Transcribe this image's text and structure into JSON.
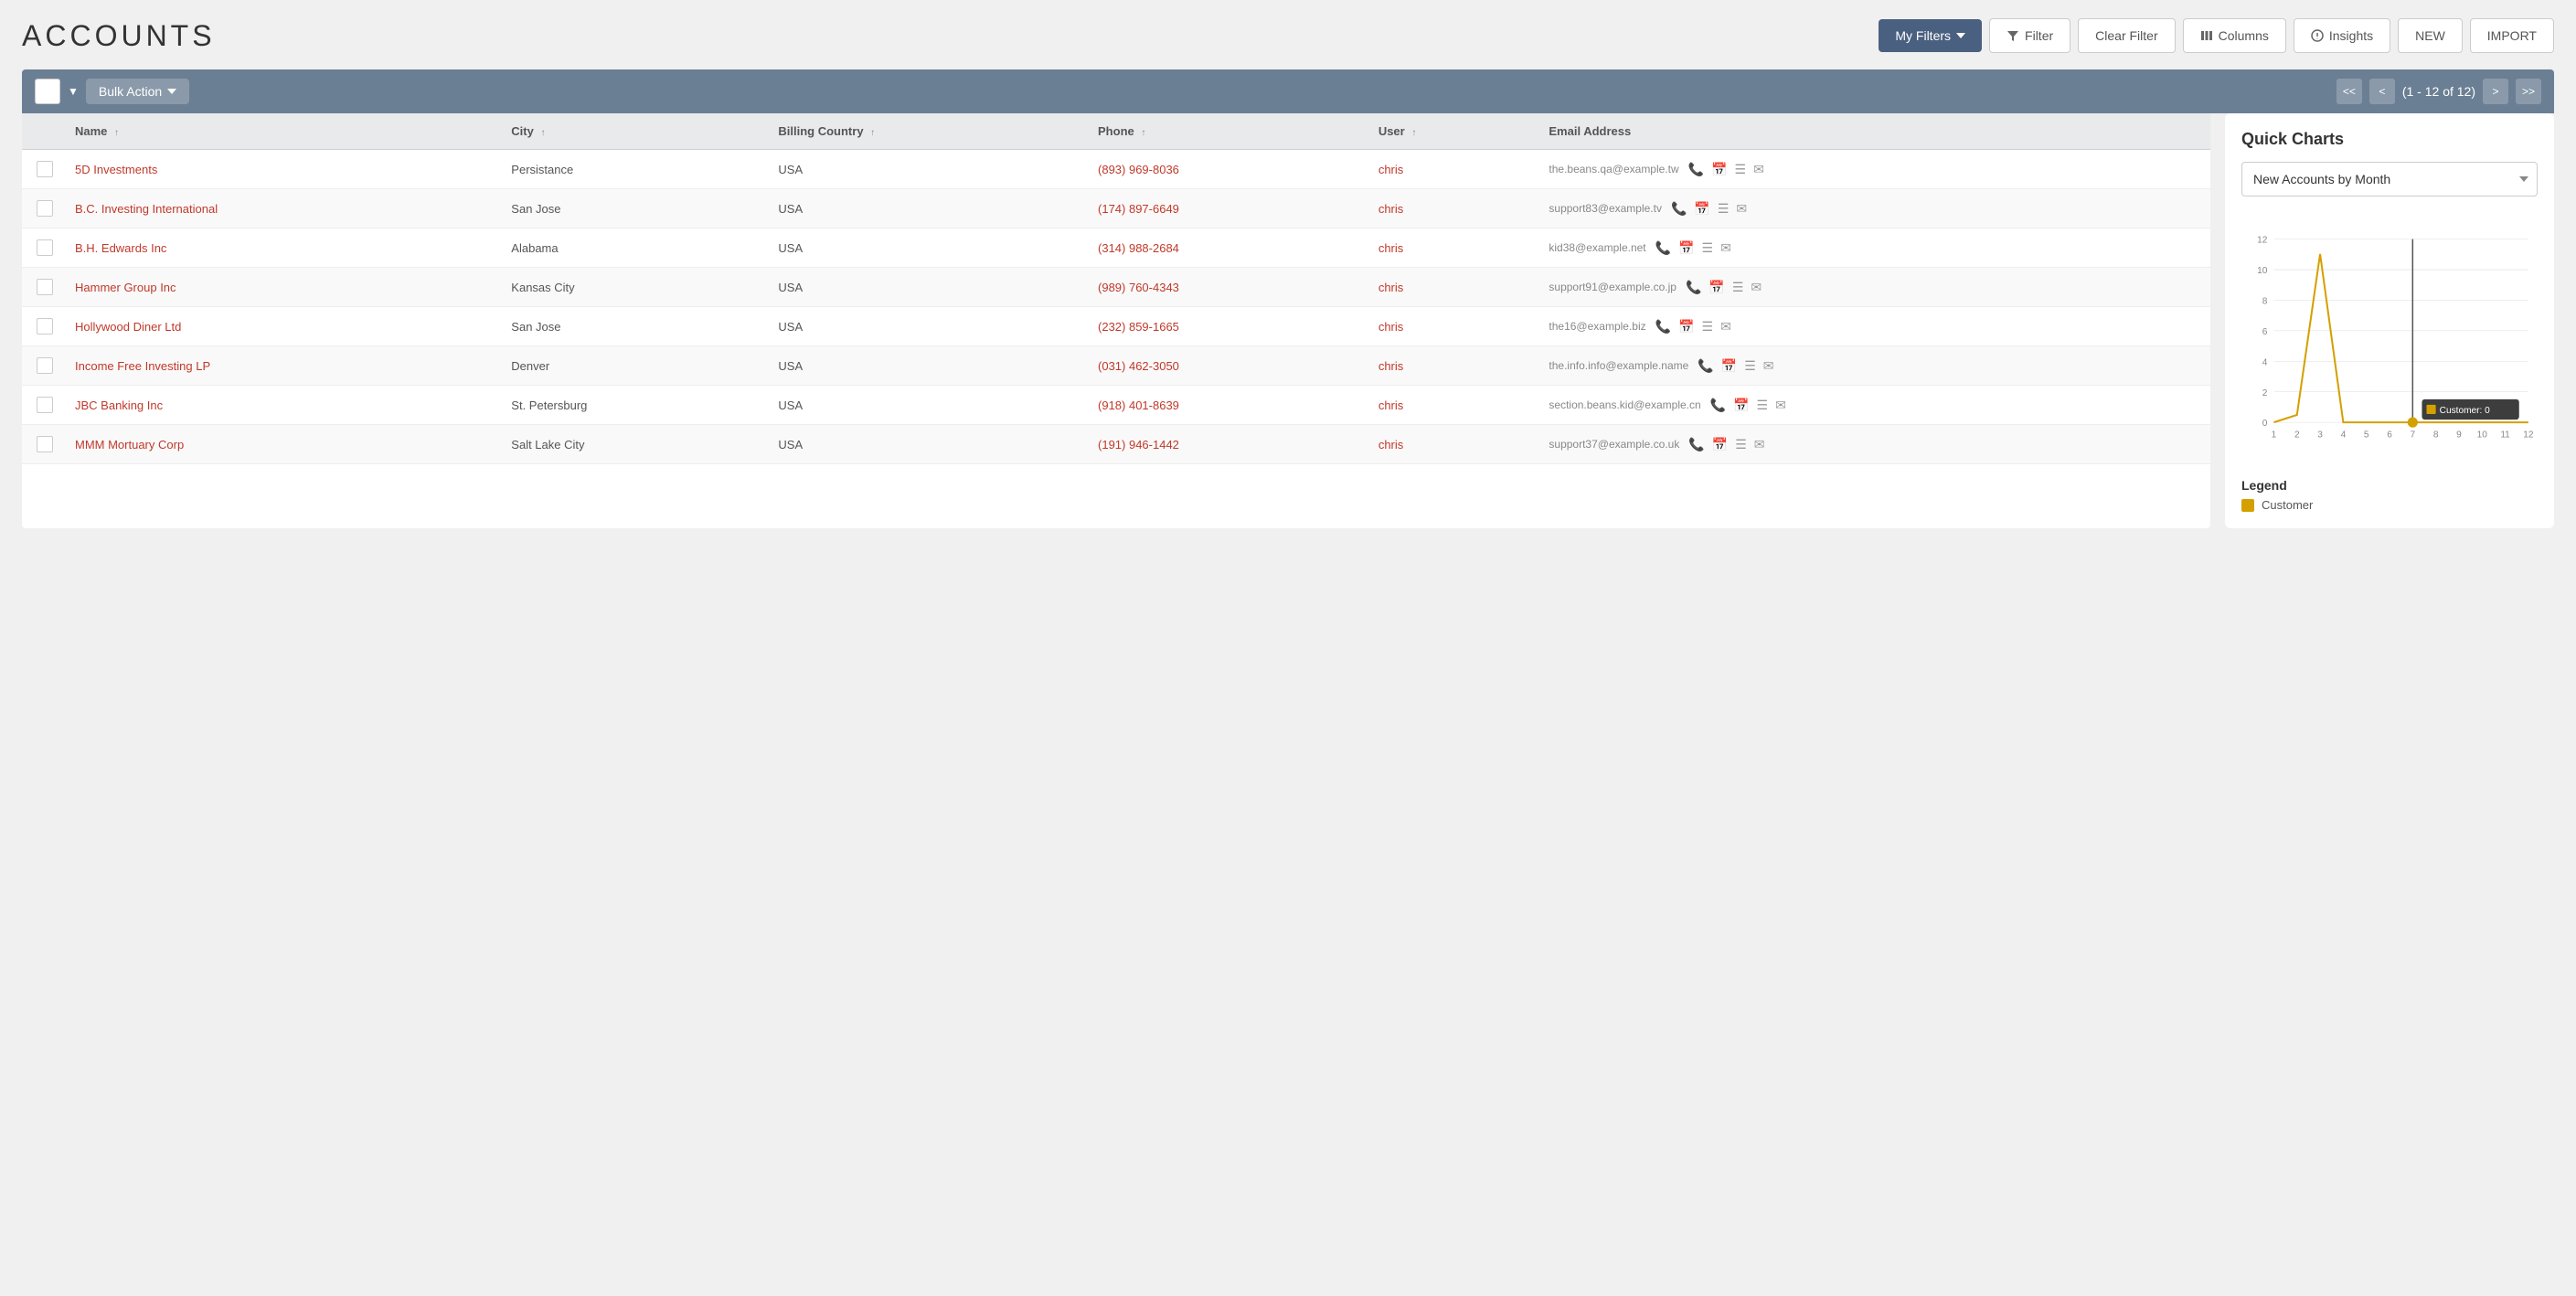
{
  "page": {
    "title": "ACCOUNTS"
  },
  "header": {
    "new_label": "NEW",
    "import_label": "IMPORT",
    "my_filters_label": "My Filters",
    "filter_label": "Filter",
    "clear_filter_label": "Clear Filter",
    "columns_label": "Columns",
    "insights_label": "Insights"
  },
  "toolbar": {
    "bulk_action_label": "Bulk Action",
    "pagination_text": "(1 - 12 of 12)",
    "first_page": "<<",
    "prev_page": "<",
    "next_page": ">",
    "last_page": ">>"
  },
  "table": {
    "columns": [
      {
        "key": "name",
        "label": "Name",
        "sortable": true
      },
      {
        "key": "city",
        "label": "City",
        "sortable": true
      },
      {
        "key": "billing_country",
        "label": "Billing Country",
        "sortable": true
      },
      {
        "key": "phone",
        "label": "Phone",
        "sortable": true
      },
      {
        "key": "user",
        "label": "User",
        "sortable": true
      },
      {
        "key": "email_address",
        "label": "Email Address",
        "sortable": false
      }
    ],
    "rows": [
      {
        "id": 1,
        "name": "5D Investments",
        "city": "Persistance",
        "billing_country": "USA",
        "phone": "(893) 969-8036",
        "user": "chris",
        "email": "the.beans.qa@example.tw"
      },
      {
        "id": 2,
        "name": "B.C. Investing International",
        "city": "San Jose",
        "billing_country": "USA",
        "phone": "(174) 897-6649",
        "user": "chris",
        "email": "support83@example.tv"
      },
      {
        "id": 3,
        "name": "B.H. Edwards Inc",
        "city": "Alabama",
        "billing_country": "USA",
        "phone": "(314) 988-2684",
        "user": "chris",
        "email": "kid38@example.net"
      },
      {
        "id": 4,
        "name": "Hammer Group Inc",
        "city": "Kansas City",
        "billing_country": "USA",
        "phone": "(989) 760-4343",
        "user": "chris",
        "email": "support91@example.co.jp"
      },
      {
        "id": 5,
        "name": "Hollywood Diner Ltd",
        "city": "San Jose",
        "billing_country": "USA",
        "phone": "(232) 859-1665",
        "user": "chris",
        "email": "the16@example.biz"
      },
      {
        "id": 6,
        "name": "Income Free Investing LP",
        "city": "Denver",
        "billing_country": "USA",
        "phone": "(031) 462-3050",
        "user": "chris",
        "email": "the.info.info@example.name"
      },
      {
        "id": 7,
        "name": "JBC Banking Inc",
        "city": "St. Petersburg",
        "billing_country": "USA",
        "phone": "(918) 401-8639",
        "user": "chris",
        "email": "section.beans.kid@example.cn"
      },
      {
        "id": 8,
        "name": "MMM Mortuary Corp",
        "city": "Salt Lake City",
        "billing_country": "USA",
        "phone": "(191) 946-1442",
        "user": "chris",
        "email": "support37@example.co.uk"
      }
    ]
  },
  "quick_charts": {
    "title": "Quick Charts",
    "dropdown_label": "New Accounts by Month",
    "dropdown_options": [
      "New Accounts by Month"
    ],
    "legend_title": "Legend",
    "legend_items": [
      {
        "label": "Customer",
        "color": "#d4a000"
      }
    ],
    "tooltip": {
      "label": "Customer: 0"
    },
    "chart": {
      "y_max": 12,
      "y_labels": [
        0,
        2,
        4,
        6,
        8,
        10,
        12
      ],
      "x_labels": [
        1,
        2,
        3,
        4,
        5,
        6,
        7,
        8,
        9,
        10,
        11,
        12
      ],
      "data_points": [
        {
          "month": 1,
          "value": 0
        },
        {
          "month": 2,
          "value": 0.5
        },
        {
          "month": 3,
          "value": 11
        },
        {
          "month": 4,
          "value": 0
        },
        {
          "month": 5,
          "value": 0
        },
        {
          "month": 6,
          "value": 0
        },
        {
          "month": 7,
          "value": 0
        },
        {
          "month": 8,
          "value": 0
        },
        {
          "month": 9,
          "value": 0
        },
        {
          "month": 10,
          "value": 0
        },
        {
          "month": 11,
          "value": 0
        },
        {
          "month": 12,
          "value": 0
        }
      ]
    }
  },
  "icons": {
    "filter": "▼",
    "sort_asc": "↑",
    "chevron_down": "▼",
    "phone_icon": "📞",
    "calendar_icon": "📅",
    "list_icon": "☰",
    "email_icon": "✉"
  }
}
